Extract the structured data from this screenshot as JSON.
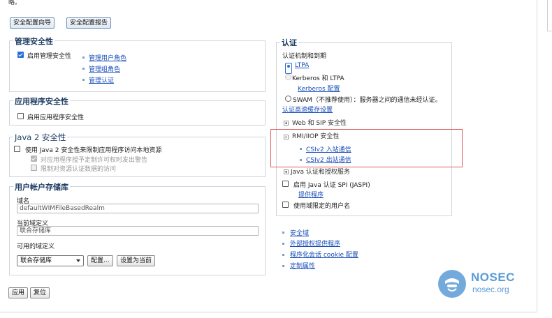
{
  "top_fragment": "略。",
  "buttons_top": {
    "wizard": "安全配置向导",
    "report": "安全配置报告"
  },
  "admin_security": {
    "title": "管理安全性",
    "checkbox_label": "启用管理安全性",
    "checked": true,
    "links": [
      "管理用户角色",
      "管理组角色",
      "管理认证"
    ]
  },
  "app_security": {
    "title": "应用程序安全性",
    "checkbox_label": "启用应用程序安全性",
    "checked": false
  },
  "java2_security": {
    "title": "Java 2 安全性",
    "checkbox_label": "使用 Java 2 安全性来限制应用程序访问本地资源",
    "checked": false,
    "sub_options": [
      {
        "label": "对应用程序授予定制许可权时发出警告",
        "checked": true
      },
      {
        "label": "限制对资源认证数据的访问",
        "checked": false
      }
    ]
  },
  "user_registry": {
    "title": "用户帐户存储库",
    "realm_label": "域名",
    "realm_value": "defaultWIMFileBasedRealm",
    "current_def_label": "当前域定义",
    "current_def_value": "联合存储库",
    "available_label": "可用的域定义",
    "select_value": "联合存储库",
    "configure_button": "配置...",
    "set_current_button": "设置为当前"
  },
  "auth": {
    "title": "认证",
    "mechanism_label": "认证机制和到期",
    "options": [
      {
        "label": "LTPA",
        "selected": true
      },
      {
        "label": "Kerberos 和 LTPA",
        "selected": false
      },
      {
        "label": "SWAM（不推荐使用）：服务器之间的通信未经认证。",
        "selected": false
      }
    ],
    "kerberos_config_link": "Kerberos 配置",
    "cache_link": "认证高速缓存设置",
    "web_sip": "Web 和 SIP 安全性",
    "rmi_iiop": "RMI/IIOP 安全性",
    "csiv2_inbound": "CSIv2 入站通信",
    "csiv2_outbound": "CSIv2 出站通信",
    "java_auth": "Java 认证和授权服务",
    "jaspi_label": "启用 Java 认证 SPI (JASPI)",
    "jaspi_checked": false,
    "providers_link": "提供程序",
    "realm_qualified_label": "使用域限定的用户名",
    "realm_qualified_checked": false
  },
  "right_links": [
    "安全域",
    "外部授权提供程序",
    "程序化会话 cookie 配置",
    "定制属性"
  ],
  "bottom_buttons": {
    "apply": "应用",
    "reset": "复位"
  },
  "watermark": {
    "brand": "NOSEC",
    "domain": "nosec.org"
  },
  "colors": {
    "accent_link": "#1a4fb8",
    "highlight_box": "#e05a5a",
    "section_title": "#1f3d63"
  }
}
